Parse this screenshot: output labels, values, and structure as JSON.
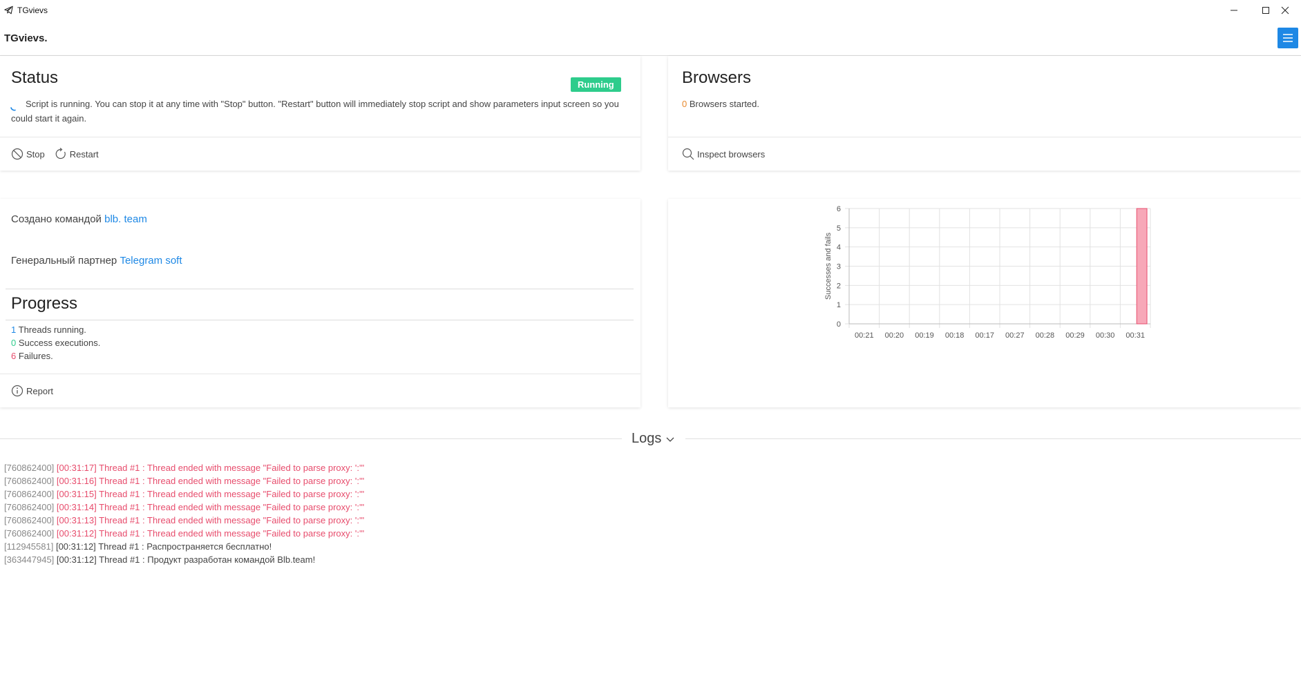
{
  "window": {
    "title": "TGvievs"
  },
  "header": {
    "brand": "TGvievs."
  },
  "status": {
    "title": "Status",
    "badge": "Running",
    "description": "Script is running. You can stop it at any time with \"Stop\" button. \"Restart\" button will immediately stop script and show parameters input screen so you could start it again.",
    "stop_label": "Stop",
    "restart_label": "Restart"
  },
  "browsers": {
    "title": "Browsers",
    "count": "0",
    "count_text": "Browsers started.",
    "inspect_label": "Inspect browsers"
  },
  "info": {
    "created_prefix": "Создано командой",
    "created_link": "blb. team",
    "partner_prefix": "Генеральный партнер",
    "partner_link": "Telegram soft"
  },
  "progress": {
    "title": "Progress",
    "threads_count": "1",
    "threads_text": "Threads running.",
    "success_count": "0",
    "success_text": "Success executions.",
    "fail_count": "6",
    "fail_text": "Failures.",
    "report_label": "Report"
  },
  "chart_data": {
    "type": "bar",
    "categories": [
      "00:21",
      "00:20",
      "00:19",
      "00:18",
      "00:17",
      "00:27",
      "00:28",
      "00:29",
      "00:30",
      "00:31"
    ],
    "series": [
      {
        "values": [
          0,
          0,
          0,
          0,
          0,
          0,
          0,
          0,
          0,
          0
        ],
        "color": "#2ecc8c"
      },
      {
        "values": [
          0,
          0,
          0,
          0,
          0,
          0,
          0,
          0,
          0,
          6
        ],
        "color": "#f7a8b8"
      }
    ],
    "ylabel": "Successes and fails",
    "yticks": [
      "0",
      "1",
      "2",
      "3",
      "4",
      "5",
      "6"
    ],
    "ylim": [
      0,
      6
    ],
    "grid": true
  },
  "logs": {
    "title": "Logs",
    "lines": [
      {
        "id": "[760862400]",
        "time": "[00:31:17]",
        "msg": "Thread #1 : Thread ended with message \"Failed to parse proxy: ':'\"",
        "error": true
      },
      {
        "id": "[760862400]",
        "time": "[00:31:16]",
        "msg": "Thread #1 : Thread ended with message \"Failed to parse proxy: ':'\"",
        "error": true
      },
      {
        "id": "[760862400]",
        "time": "[00:31:15]",
        "msg": "Thread #1 : Thread ended with message \"Failed to parse proxy: ':'\"",
        "error": true
      },
      {
        "id": "[760862400]",
        "time": "[00:31:14]",
        "msg": "Thread #1 : Thread ended with message \"Failed to parse proxy: ':'\"",
        "error": true
      },
      {
        "id": "[760862400]",
        "time": "[00:31:13]",
        "msg": "Thread #1 : Thread ended with message \"Failed to parse proxy: ':'\"",
        "error": true
      },
      {
        "id": "[760862400]",
        "time": "[00:31:12]",
        "msg": "Thread #1 : Thread ended with message \"Failed to parse proxy: ':'\"",
        "error": true
      },
      {
        "id": "[112945581]",
        "time": "[00:31:12]",
        "msg": "Thread #1 : Распространяется бесплатно!",
        "error": false
      },
      {
        "id": "[363447945]",
        "time": "[00:31:12]",
        "msg": "Thread #1 : Продукт разработан командой Blb.team!",
        "error": false
      }
    ]
  }
}
